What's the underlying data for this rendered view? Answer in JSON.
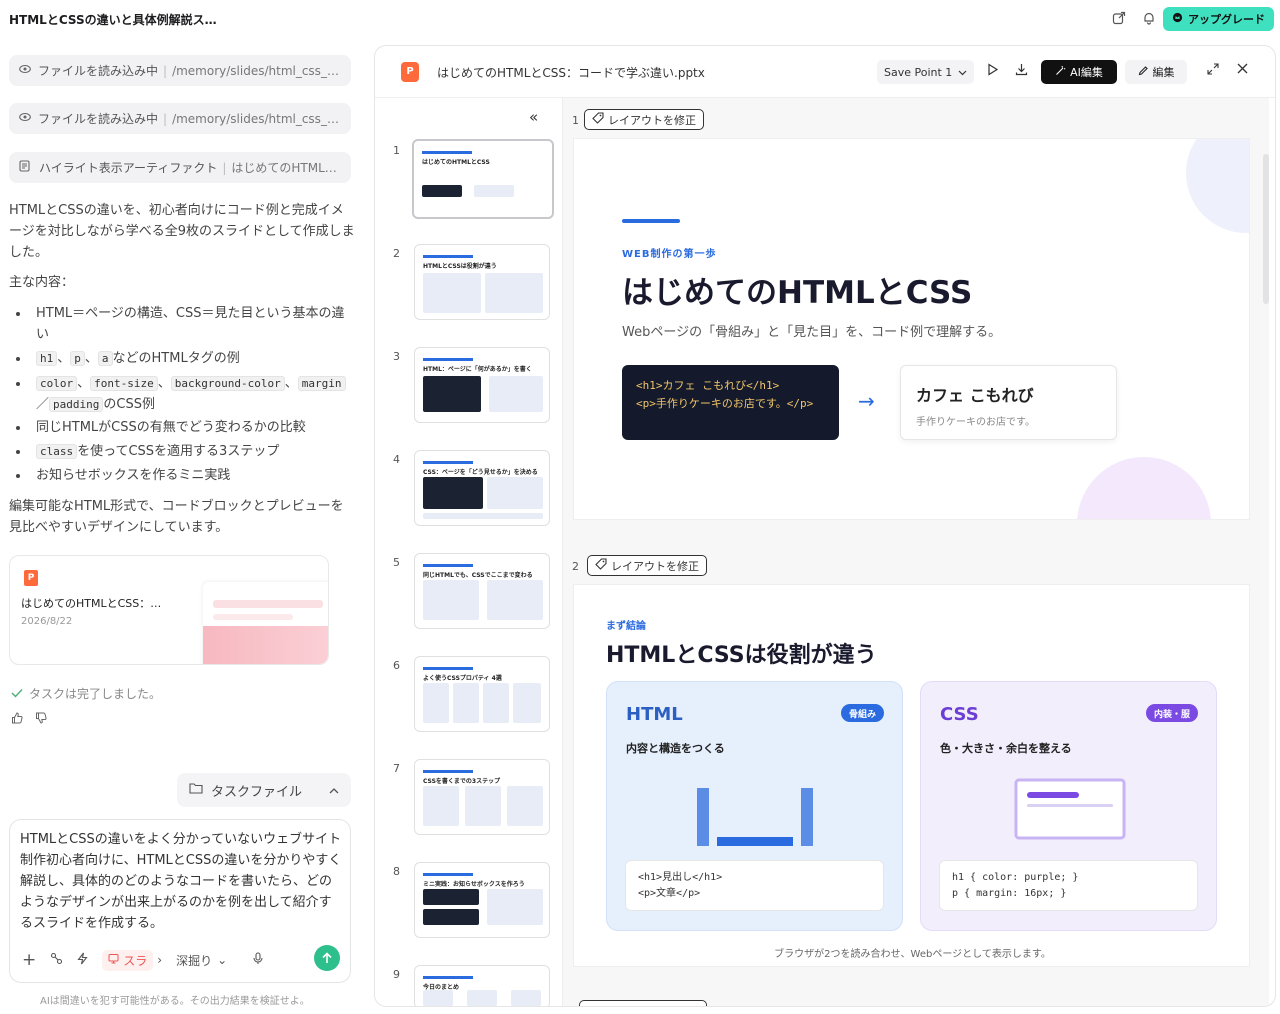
{
  "app": {
    "title": "HTMLとCSSの違いと具体例解説ス…",
    "upgrade_label": "アップグレード"
  },
  "chat": {
    "chips": [
      {
        "label": "ファイルを読み込み中",
        "path": "/memory/slides/html_css_be…",
        "icon": "eye-icon"
      },
      {
        "label": "ファイルを読み込み中",
        "path": "/memory/slides/html_css_be…",
        "icon": "eye-icon"
      },
      {
        "label": "ハイライト表示アーティファクト",
        "path": "はじめてのHTML…",
        "icon": "document-icon"
      }
    ],
    "intro": "HTMLとCSSの違いを、初心者向けにコード例と完成イメージを対比しながら学べる全9枚のスライドとして作成しました。",
    "contents_label": "主な内容：",
    "bullets": [
      {
        "text": "HTML＝ページの構造、CSS＝見た目という基本の違い"
      },
      {
        "c1": "h1",
        "s1": "、",
        "c2": "p",
        "s2": "、",
        "c3": "a",
        "rest": "などのHTMLタグの例"
      },
      {
        "c1": "color",
        "s1": "、",
        "c2": "font-size",
        "s2": "、",
        "c3": "background-color",
        "s3": "、",
        "c4": "margin",
        "s4": "／",
        "c5": "padding",
        "rest": "のCSS例"
      },
      {
        "text": "同じHTMLがCSSの有無でどう変わるかの比較"
      },
      {
        "c1": "class",
        "rest": "を使ってCSSを適用する3ステップ"
      },
      {
        "text": "お知らせボックスを作るミニ実践"
      }
    ],
    "outro": "編集可能なHTML形式で、コードブロックとプレビューを見比べやすいデザインにしています。",
    "file_card": {
      "name": "はじめてのHTMLとCSS：…",
      "date": "2026/8/22",
      "icon_letter": "P"
    },
    "done_text": "タスクは完了しました。",
    "task_files_label": "タスクファイル",
    "input_text": "HTMLとCSSの違いをよく分かっていないウェブサイト制作初心者向けに、HTMLとCSSの違いを分かりやすく解説し、具体的のどのようなコードを書いたら、どのようなデザインが出来上がるのかを例を出して紹介するスライドを作成する。",
    "slide_mode_label": "スラ",
    "depth_label": "深掘り",
    "disclaimer": "AIは間違いを犯す可能性がある。その出力結果を検証せよ。"
  },
  "viewer": {
    "file_title": "はじめてのHTMLとCSS：コードで学ぶ違い.pptx",
    "icon_letter": "P",
    "save_point": "Save Point 1",
    "ai_edit_label": "AI編集",
    "edit_label": "編集",
    "fix_layout_label": "レイアウトを修正",
    "thumbnails": [
      {
        "num": "1",
        "title": "はじめてのHTMLとCSS"
      },
      {
        "num": "2",
        "title": "HTMLとCSSは役割が違う"
      },
      {
        "num": "3",
        "title": "HTML：ページに「何があるか」を書く"
      },
      {
        "num": "4",
        "title": "CSS：ページを「どう見せるか」を決める"
      },
      {
        "num": "5",
        "title": "同じHTMLでも、CSSでここまで変わる"
      },
      {
        "num": "6",
        "title": "よく使うCSSプロパティ 4選"
      },
      {
        "num": "7",
        "title": "CSSを書くまでの3ステップ"
      },
      {
        "num": "8",
        "title": "ミニ実践：お知らせボックスを作ろう"
      },
      {
        "num": "9",
        "title": "今日のまとめ"
      }
    ],
    "slide1": {
      "num": "1",
      "kicker": "WEB制作の第一歩",
      "title": "はじめてのHTMLとCSS",
      "subtitle": "Webページの「骨組み」と「見た目」を、コード例で理解する。",
      "code_line1": "<h1>カフェ こもれび</h1>",
      "code_line2": "<p>手作りケーキのお店です。</p>",
      "arrow": "→",
      "preview_title": "カフェ こもれび",
      "preview_text": "手作りケーキのお店です。"
    },
    "slide2": {
      "num": "2",
      "kicker": "まず結論",
      "title": "HTMLとCSSは役割が違う",
      "html_title": "HTML",
      "html_badge": "骨組み",
      "html_desc": "内容と構造をつくる",
      "html_code1": "<h1>見出し</h1>",
      "html_code2": "<p>文章</p>",
      "css_title": "CSS",
      "css_badge": "内装・服",
      "css_desc": "色・大きさ・余白を整える",
      "css_code1": "h1 { color: purple; }",
      "css_code2": "p { margin: 16px; }",
      "footer": "ブラウザが2つを読み合わせ、Webページとして表示します。"
    }
  }
}
